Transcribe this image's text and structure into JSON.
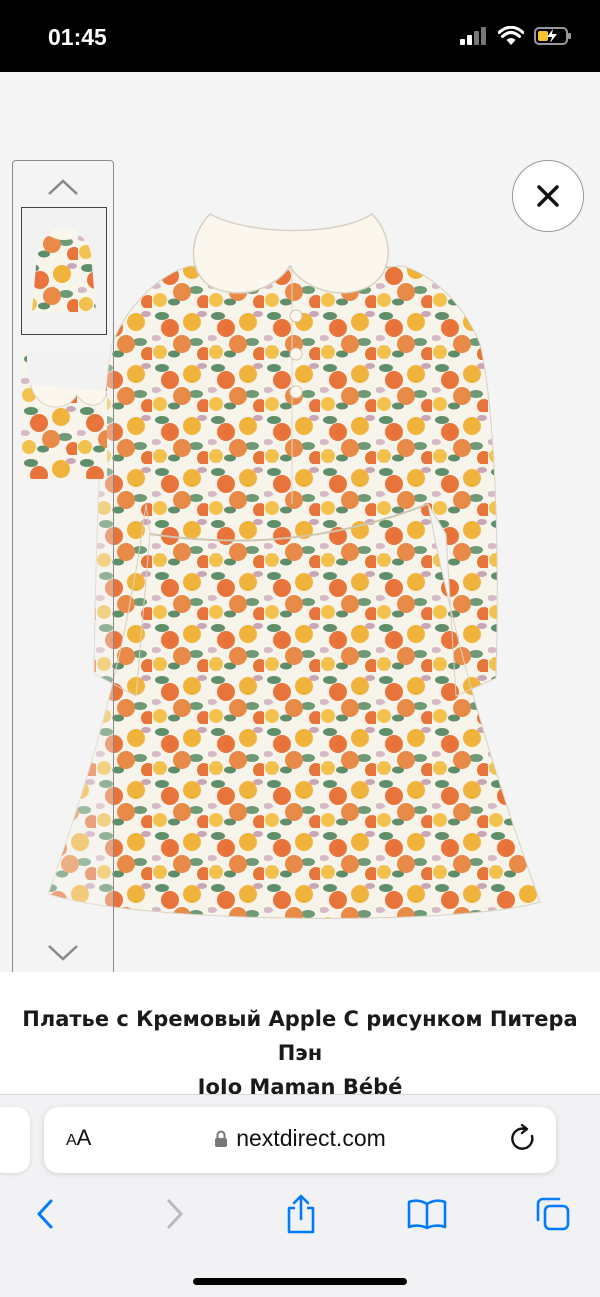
{
  "status_bar": {
    "time": "01:45"
  },
  "product": {
    "title_line1": "Платье с Кремовый Apple С рисунком Питера Пэн",
    "title_line2": "JoJo Maman Bébé"
  },
  "browser": {
    "text_size_large": "A",
    "text_size_small": "A",
    "url": "nextdirect.com"
  },
  "icons": {
    "signal": "cellular-signal-icon",
    "wifi": "wifi-icon",
    "battery": "battery-charging-icon",
    "close": "close-icon",
    "thumb_up": "chevron-up-icon",
    "thumb_down": "chevron-down-icon",
    "lock": "lock-icon",
    "reload": "reload-icon",
    "back": "back-icon",
    "forward": "forward-icon",
    "share": "share-icon",
    "bookmarks": "bookmarks-icon",
    "tabs": "tabs-icon"
  },
  "colors": {
    "accent": "#007aff",
    "disabled": "#b8b8bd",
    "orange": "#e8743b",
    "yellow": "#f0b43c",
    "leaf": "#5f8f6a",
    "collar": "#fbf7ee"
  }
}
